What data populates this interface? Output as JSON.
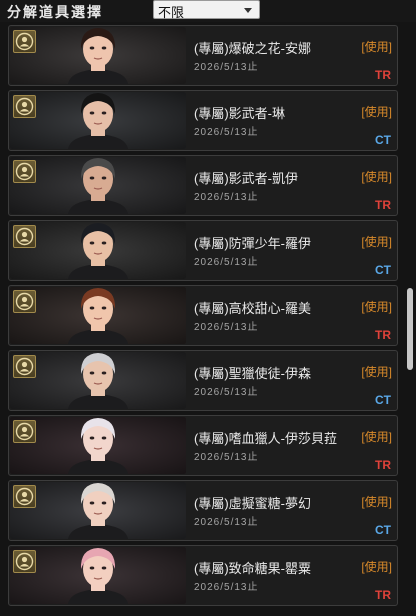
{
  "header": {
    "title": "分解道具選擇",
    "filter": {
      "selected": "不限"
    }
  },
  "items": [
    {
      "name": "(專屬)爆破之花-安娜",
      "expiry": "2026/5/13止",
      "action": "[使用]",
      "team": "TR",
      "team_color": "#e0423a",
      "avatar": {
        "bg": "#3d3a3a",
        "skin": "#efc5ae",
        "hair": "#2a1a15"
      }
    },
    {
      "name": "(專屬)影武者-琳",
      "expiry": "2026/5/13止",
      "action": "[使用]",
      "team": "CT",
      "team_color": "#5aa8e8",
      "avatar": {
        "bg": "#3a3c3f",
        "skin": "#e6bfa8",
        "hair": "#141414"
      }
    },
    {
      "name": "(專屬)影武者-凱伊",
      "expiry": "2026/5/13止",
      "action": "[使用]",
      "team": "TR",
      "team_color": "#e0423a",
      "avatar": {
        "bg": "#38383a",
        "skin": "#d8ab92",
        "hair": "#4a4a4a"
      }
    },
    {
      "name": "(專屬)防彈少年-羅伊",
      "expiry": "2026/5/13止",
      "action": "[使用]",
      "team": "CT",
      "team_color": "#5aa8e8",
      "avatar": {
        "bg": "#3a3a3a",
        "skin": "#e8c0a5",
        "hair": "#1b1d22"
      }
    },
    {
      "name": "(專屬)高校甜心-羅美",
      "expiry": "2026/5/13止",
      "action": "[使用]",
      "team": "TR",
      "team_color": "#e0423a",
      "avatar": {
        "bg": "#3c3432",
        "skin": "#f0c6ac",
        "hair": "#7a3a22"
      }
    },
    {
      "name": "(專屬)聖獵使徒-伊森",
      "expiry": "2026/5/13止",
      "action": "[使用]",
      "team": "CT",
      "team_color": "#5aa8e8",
      "avatar": {
        "bg": "#3b3b3d",
        "skin": "#e7c4ae",
        "hair": "#cfcfd2"
      }
    },
    {
      "name": "(專屬)嗜血獵人-伊莎貝菈",
      "expiry": "2026/5/13止",
      "action": "[使用]",
      "team": "TR",
      "team_color": "#e0423a",
      "avatar": {
        "bg": "#3a2f33",
        "skin": "#f2d6cc",
        "hair": "#e8e3ea"
      }
    },
    {
      "name": "(專屬)虛擬蜜糖-夢幻",
      "expiry": "2026/5/13止",
      "action": "[使用]",
      "team": "CT",
      "team_color": "#5aa8e8",
      "avatar": {
        "bg": "#3d3e42",
        "skin": "#f0d0c0",
        "hair": "#dad6d2"
      }
    },
    {
      "name": "(專屬)致命糖果-罌粟",
      "expiry": "2026/5/13止",
      "action": "[使用]",
      "team": "TR",
      "team_color": "#e0423a",
      "avatar": {
        "bg": "#3c3336",
        "skin": "#f3cfc0",
        "hair": "#e7a6b2"
      }
    }
  ]
}
